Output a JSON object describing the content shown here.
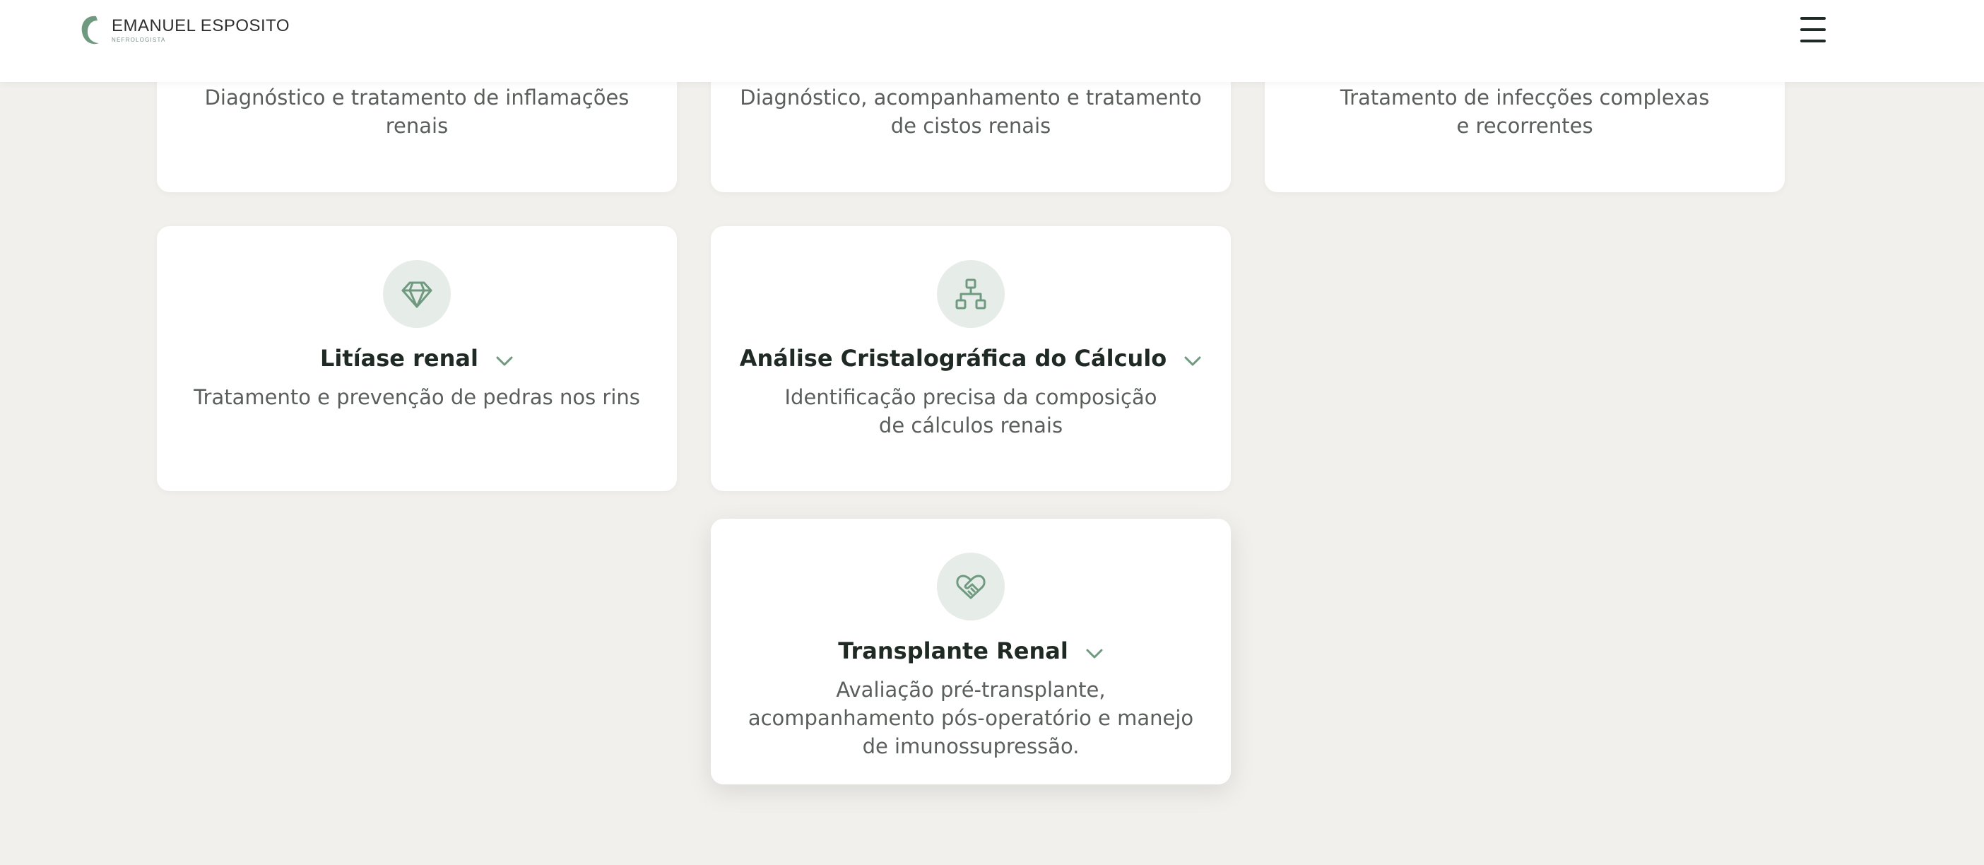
{
  "header": {
    "logo_name": "EMANUEL ESPOSITO",
    "logo_subtitle": "NEFROLOGISTA",
    "menu_icon": "hamburger-menu-icon"
  },
  "colors": {
    "page_background": "#f1f0ec",
    "card_background": "#ffffff",
    "accent_green": "#6f9a80",
    "icon_circle": "#e6ece8",
    "title_text": "#1f2a25",
    "body_text": "#5b5f5c"
  },
  "cards": [
    {
      "description": "Diagnóstico e tratamento de inflamações renais"
    },
    {
      "description": "Diagnóstico, acompanhamento e tratamento de cistos renais"
    },
    {
      "description": "Tratamento de infecções complexas e recorrentes"
    },
    {
      "icon": "gem-icon",
      "title": "Litíase renal",
      "description": "Tratamento e prevenção de pedras nos rins"
    },
    {
      "icon": "network-hierarchy-icon",
      "title": "Análise Cristalográfica do Cálculo",
      "description": "Identificação precisa da composição de cálculos renais"
    },
    {
      "icon": "heart-handshake-icon",
      "title": "Transplante Renal",
      "description": "Avaliação pré-transplante, acompanhamento pós-operatório e manejo de imunossupressão."
    }
  ]
}
